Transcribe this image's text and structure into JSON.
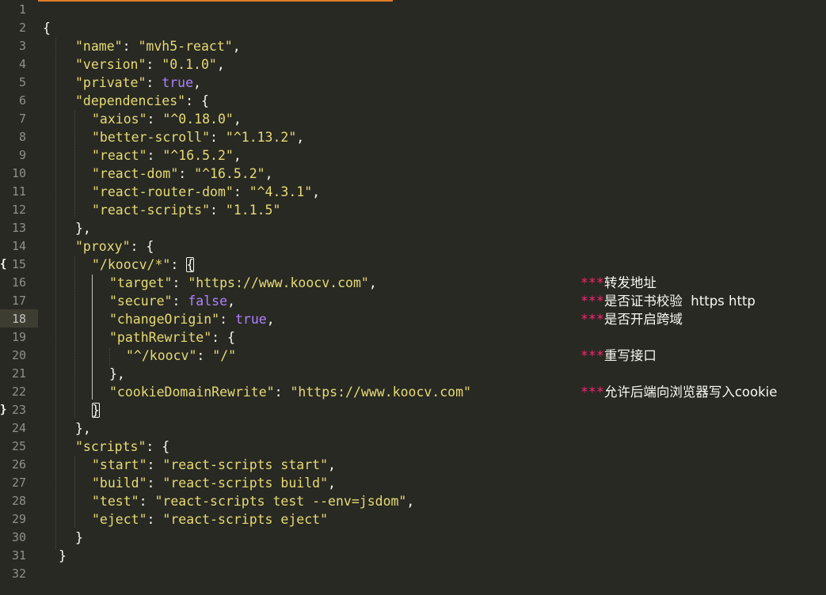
{
  "editor": {
    "line_numbers": [
      "1",
      "2",
      "3",
      "4",
      "5",
      "6",
      "7",
      "8",
      "9",
      "10",
      "11",
      "12",
      "13",
      "14",
      "15",
      "16",
      "17",
      "18",
      "19",
      "20",
      "21",
      "22",
      "23",
      "24",
      "25",
      "26",
      "27",
      "28",
      "29",
      "30",
      "31",
      "32"
    ],
    "fold_open": "{",
    "fold_close": "}",
    "lines": {
      "l2": "{",
      "l3": {
        "k": "\"name\"",
        "sep": ": ",
        "v": "\"mvh5-react\"",
        "end": ","
      },
      "l4": {
        "k": "\"version\"",
        "sep": ": ",
        "v": "\"0.1.0\"",
        "end": ","
      },
      "l5": {
        "k": "\"private\"",
        "sep": ": ",
        "v": "true",
        "end": ","
      },
      "l6": {
        "k": "\"dependencies\"",
        "sep": ": ",
        "v": "{"
      },
      "l7": {
        "k": "\"axios\"",
        "sep": ": ",
        "v": "\"^0.18.0\"",
        "end": ","
      },
      "l8": {
        "k": "\"better-scroll\"",
        "sep": ": ",
        "v": "\"^1.13.2\"",
        "end": ","
      },
      "l9": {
        "k": "\"react\"",
        "sep": ": ",
        "v": "\"^16.5.2\"",
        "end": ","
      },
      "l10": {
        "k": "\"react-dom\"",
        "sep": ": ",
        "v": "\"^16.5.2\"",
        "end": ","
      },
      "l11": {
        "k": "\"react-router-dom\"",
        "sep": ": ",
        "v": "\"^4.3.1\"",
        "end": ","
      },
      "l12": {
        "k": "\"react-scripts\"",
        "sep": ": ",
        "v": "\"1.1.5\""
      },
      "l13": "},",
      "l14": {
        "k": "\"proxy\"",
        "sep": ": ",
        "v": "{"
      },
      "l15": {
        "k": "\"/koocv/*\"",
        "sep": ": ",
        "v": "{"
      },
      "l16": {
        "k": "\"target\"",
        "sep": ": ",
        "v": "\"https://www.koocv.com\"",
        "end": ","
      },
      "l17": {
        "k": "\"secure\"",
        "sep": ": ",
        "v": "false",
        "end": ","
      },
      "l18": {
        "k": "\"changeOrigin\"",
        "sep": ": ",
        "v": "true",
        "end": ","
      },
      "l19": {
        "k": "\"pathRewrite\"",
        "sep": ": ",
        "v": "{"
      },
      "l20": {
        "k": "\"^/koocv\"",
        "sep": ": ",
        "v": "\"/\""
      },
      "l21": "},",
      "l22": {
        "k": "\"cookieDomainRewrite\"",
        "sep": ": ",
        "v": "\"https://www.koocv.com\""
      },
      "l23": "}",
      "l24": "},",
      "l25": {
        "k": "\"scripts\"",
        "sep": ": ",
        "v": "{"
      },
      "l26": {
        "k": "\"start\"",
        "sep": ": ",
        "v": "\"react-scripts start\"",
        "end": ","
      },
      "l27": {
        "k": "\"build\"",
        "sep": ": ",
        "v": "\"react-scripts build\"",
        "end": ","
      },
      "l28": {
        "k": "\"test\"",
        "sep": ": ",
        "v": "\"react-scripts test --env=jsdom\"",
        "end": ","
      },
      "l29": {
        "k": "\"eject\"",
        "sep": ": ",
        "v": "\"react-scripts eject\""
      },
      "l30": "}",
      "l31": "}"
    },
    "comments": {
      "c16": {
        "mark": "***",
        "text": "转发地址"
      },
      "c17": {
        "mark": "***",
        "text": "是否证书校验  https http"
      },
      "c18": {
        "mark": "***",
        "text": "是否开启跨域"
      },
      "c20": {
        "mark": "***",
        "text": "重写接口"
      },
      "c22": {
        "mark": "***",
        "text": "允许后端向浏览器写入cookie"
      }
    }
  },
  "colors": {
    "background": "#282923",
    "string": "#e6db74",
    "boolean": "#ae81ff",
    "marker": "#f92672",
    "tab_accent": "#e07b2a"
  }
}
